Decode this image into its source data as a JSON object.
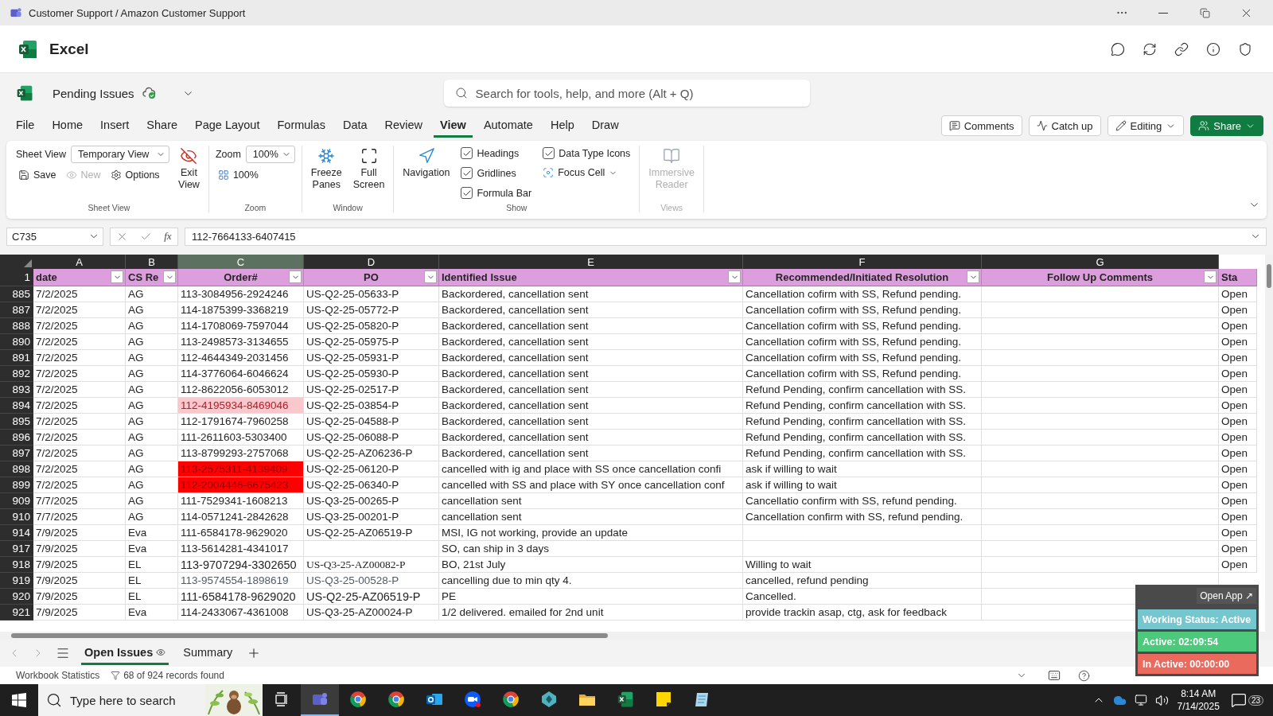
{
  "window": {
    "title": "Customer Support / Amazon Customer Support"
  },
  "app": {
    "name": "Excel"
  },
  "file": {
    "name": "Pending Issues",
    "search_placeholder": "Search for tools, help, and more (Alt + Q)"
  },
  "ribbon_tabs": [
    {
      "label": "File",
      "selected": false
    },
    {
      "label": "Home",
      "selected": false
    },
    {
      "label": "Insert",
      "selected": false
    },
    {
      "label": "Share",
      "selected": false
    },
    {
      "label": "Page Layout",
      "selected": false
    },
    {
      "label": "Formulas",
      "selected": false
    },
    {
      "label": "Data",
      "selected": false
    },
    {
      "label": "Review",
      "selected": false
    },
    {
      "label": "View",
      "selected": true
    },
    {
      "label": "Automate",
      "selected": false
    },
    {
      "label": "Help",
      "selected": false
    },
    {
      "label": "Draw",
      "selected": false
    }
  ],
  "actions": [
    {
      "kind": "comments",
      "label": "Comments"
    },
    {
      "kind": "catchup",
      "label": "Catch up"
    },
    {
      "kind": "editing",
      "label": "Editing"
    },
    {
      "kind": "share",
      "label": "Share"
    }
  ],
  "ribbon": {
    "sheet_view": {
      "label": "Sheet View",
      "view": "Temporary View",
      "save": "Save",
      "new": "New",
      "new_disabled": true,
      "options": "Options",
      "exit": [
        "Exit",
        "View"
      ],
      "group": "Sheet View"
    },
    "zoom": {
      "label": "Zoom",
      "value": "100%",
      "reset": "100%",
      "group": "Zoom"
    },
    "window": {
      "freeze": [
        "Freeze",
        "Panes"
      ],
      "full": [
        "Full",
        "Screen"
      ],
      "group": "Window"
    },
    "show": {
      "navigation": "Navigation",
      "checks": [
        {
          "label": "Headings",
          "checked": true
        },
        {
          "label": "Gridlines",
          "checked": true
        },
        {
          "label": "Formula Bar",
          "checked": true
        },
        {
          "label": "Data Type Icons",
          "checked": true
        }
      ],
      "focus": "Focus Cell",
      "group": "Show"
    },
    "views": {
      "reader": [
        "Immersive",
        "Reader"
      ],
      "disabled": true,
      "group": "Views"
    }
  },
  "formula_bar": {
    "name_box": "C735",
    "function_label": "fx",
    "value": "112-7664133-6407415"
  },
  "columns": [
    {
      "letter": "A",
      "selected": false
    },
    {
      "letter": "B",
      "selected": false
    },
    {
      "letter": "C",
      "selected": true
    },
    {
      "letter": "D",
      "selected": false
    },
    {
      "letter": "E",
      "selected": false
    },
    {
      "letter": "F",
      "selected": false
    },
    {
      "letter": "G",
      "selected": false
    }
  ],
  "header_row": {
    "number": "1",
    "cells": [
      "date",
      "CS Re",
      "Order#",
      "PO",
      "Identified Issue",
      "Recommended/Initiated Resolution",
      "Follow Up Comments",
      "Sta"
    ]
  },
  "rows": [
    {
      "n": "885",
      "date": "7/2/2025",
      "rep": "AG",
      "order": "113-3084956-2924246",
      "po": "US-Q2-25-05633-P",
      "issue": "Backordered, cancellation sent",
      "resolution": "Cancellation cofirm with SS, Refund pending.",
      "status": "Open"
    },
    {
      "n": "887",
      "date": "7/2/2025",
      "rep": "AG",
      "order": "114-1875399-3368219",
      "po": "US-Q2-25-05772-P",
      "issue": "Backordered, cancellation sent",
      "resolution": "Cancellation cofirm with SS, Refund pending.",
      "status": "Open"
    },
    {
      "n": "888",
      "date": "7/2/2025",
      "rep": "AG",
      "order": "114-1708069-7597044",
      "po": "US-Q2-25-05820-P",
      "issue": "Backordered, cancellation sent",
      "resolution": "Cancellation cofirm with SS, Refund pending.",
      "status": "Open"
    },
    {
      "n": "890",
      "date": "7/2/2025",
      "rep": "AG",
      "order": "113-2498573-3134655",
      "po": "US-Q2-25-05975-P",
      "issue": "Backordered, cancellation sent",
      "resolution": "Cancellation cofirm with SS, Refund pending.",
      "status": "Open"
    },
    {
      "n": "891",
      "date": "7/2/2025",
      "rep": "AG",
      "order": "112-4644349-2031456",
      "po": "US-Q2-25-05931-P",
      "issue": "Backordered, cancellation sent",
      "resolution": "Cancellation cofirm with SS, Refund pending.",
      "status": "Open"
    },
    {
      "n": "892",
      "date": "7/2/2025",
      "rep": "AG",
      "order": "114-3776064-6046624",
      "po": "US-Q2-25-05930-P",
      "issue": "Backordered, cancellation sent",
      "resolution": "Cancellation cofirm with SS, Refund pending.",
      "status": "Open"
    },
    {
      "n": "893",
      "date": "7/2/2025",
      "rep": "AG",
      "order": "112-8622056-6053012",
      "po": "US-Q2-25-02517-P",
      "issue": "Backordered, cancellation sent",
      "resolution": "Refund Pending, confirm cancellation with SS.",
      "status": "Open"
    },
    {
      "n": "894",
      "date": "7/2/2025",
      "rep": "AG",
      "order": {
        "text": "112-4195934-8469046",
        "color": "#f8c8cc"
      },
      "po": "US-Q2-25-03854-P",
      "issue": "Backordered, cancellation sent",
      "resolution": "Refund Pending, confirm cancellation with SS.",
      "status": "Open"
    },
    {
      "n": "895",
      "date": "7/2/2025",
      "rep": "AG",
      "order": "112-1791674-7960258",
      "po": "US-Q2-25-04588-P",
      "issue": "Backordered, cancellation sent",
      "resolution": "Refund Pending, confirm cancellation with SS.",
      "status": "Open"
    },
    {
      "n": "896",
      "date": "7/2/2025",
      "rep": "AG",
      "order": "111-2611603-5303400",
      "po": "US-Q2-25-06088-P",
      "issue": "Backordered, cancellation sent",
      "resolution": "Refund Pending, confirm cancellation with SS.",
      "status": "Open"
    },
    {
      "n": "897",
      "date": "7/2/2025",
      "rep": "AG",
      "order": "113-8799293-2757068",
      "po": "US-Q2-25-AZ06236-P",
      "issue": "Backordered, cancellation sent",
      "resolution": "Refund Pending, confirm cancellation with SS.",
      "status": "Open"
    },
    {
      "n": "898",
      "date": "7/2/2025",
      "rep": "AG",
      "order": {
        "text": "113-2575311-4139409",
        "color": "#ff0000"
      },
      "po": "US-Q2-25-06120-P",
      "issue": "cancelled with ig and place with SS once cancellation confi",
      "resolution": "ask if willing to wait",
      "status": "Open"
    },
    {
      "n": "899",
      "date": "7/2/2025",
      "rep": "AG",
      "order": {
        "text": "112-2004446-6675423",
        "color": "#ff0000"
      },
      "po": "US-Q2-25-06340-P",
      "issue": "cancelled with SS and place with SY once cancellation conf",
      "resolution": "ask if willing to wait",
      "status": "Open"
    },
    {
      "n": "909",
      "date": "7/7/2025",
      "rep": "AG",
      "order": "111-7529341-1608213",
      "po": "US-Q3-25-00265-P",
      "issue": "cancellation sent",
      "resolution": "Cancellatio confirm with SS, refund pending.",
      "status": "Open"
    },
    {
      "n": "910",
      "date": "7/7/2025",
      "rep": "AG",
      "order": "114-0571241-2842628",
      "po": "US-Q3-25-00201-P",
      "issue": "cancellation sent",
      "resolution": "Cancellation confirm with SS, refund pending.",
      "status": "Open"
    },
    {
      "n": "914",
      "date": "7/9/2025",
      "rep": "Eva",
      "order": "111-6584178-9629020",
      "po": "US-Q2-25-AZ06519-P",
      "issue": "MSI, IG not working, provide an update",
      "status": "Open"
    },
    {
      "n": "917",
      "date": "7/9/2025",
      "rep": "Eva",
      "order": "113-5614281-4341017",
      "issue": "SO, can ship in 3 days",
      "status": "Open"
    },
    {
      "n": "918",
      "date": "7/9/2025",
      "rep": "EL",
      "order": {
        "text": "113-9707294-3302650",
        "large": true
      },
      "po": {
        "text": "US-Q3-25-AZ00082-P",
        "serif": true
      },
      "issue": "BO, 21st July",
      "resolution": "Willing to wait",
      "status": "Open"
    },
    {
      "n": "919",
      "date": "7/9/2025",
      "rep": "EL",
      "order": {
        "text": "113-9574554-1898619",
        "muted": true
      },
      "po": {
        "text": "US-Q3-25-00528-P",
        "muted": true
      },
      "issue": "cancelling due to min qty 4.",
      "resolution": "cancelled, refund pending"
    },
    {
      "n": "920",
      "date": "7/9/2025",
      "rep": "EL",
      "order": {
        "text": "111-6584178-9629020",
        "large": true
      },
      "po": {
        "text": "US-Q2-25-AZ06519-P",
        "large": true
      },
      "issue": "PE",
      "resolution": "Cancelled."
    },
    {
      "n": "921",
      "date": "7/9/2025",
      "rep": "Eva",
      "order": "114-2433067-4361008",
      "po": "US-Q3-25-AZ00024-P",
      "issue": "1/2 delivered. emailed for 2nd unit",
      "resolution": "provide trackin asap, ctg, ask for feedback"
    }
  ],
  "sheet_tabs": [
    {
      "label": "Open Issues",
      "selected": true
    },
    {
      "label": "Summary",
      "selected": false
    }
  ],
  "status_bar": {
    "statistics": "Workbook Statistics",
    "filter": "68 of 924 records found"
  },
  "tracker": {
    "open_app": "Open App ↗",
    "working": "Working Status: Active",
    "active": "Active: 02:09:54",
    "inactive": "In Active: 00:00:00"
  },
  "taskbar": {
    "search_placeholder": "Type here to search",
    "apps": [
      {
        "kind": "chat",
        "selected": true
      },
      {
        "kind": "browser",
        "selected": false
      },
      {
        "kind": "browser",
        "selected": false
      },
      {
        "kind": "mail",
        "selected": false
      },
      {
        "kind": "video",
        "selected": false
      },
      {
        "kind": "browser",
        "selected": false
      },
      {
        "kind": "gem",
        "selected": false
      },
      {
        "kind": "folder",
        "selected": false
      },
      {
        "kind": "sheet",
        "selected": false
      },
      {
        "kind": "note",
        "selected": false
      },
      {
        "kind": "pad",
        "selected": false
      }
    ],
    "time": "8:14 AM",
    "date": "7/14/2025",
    "notifications": "23"
  }
}
